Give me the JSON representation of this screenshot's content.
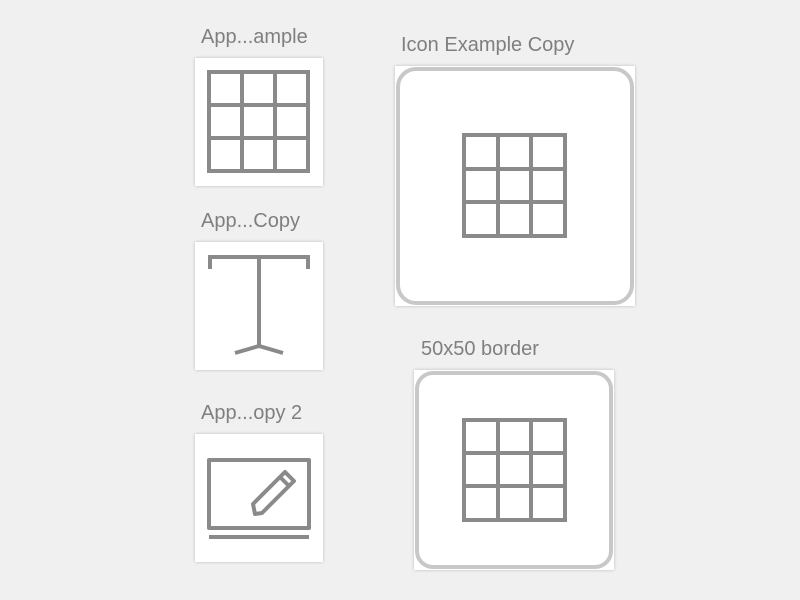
{
  "artboards": [
    {
      "label": "App...ample",
      "icon": "grid-icon"
    },
    {
      "label": "App...Copy",
      "icon": "text-cursor-icon"
    },
    {
      "label": "App...opy 2",
      "icon": "edit-screen-icon"
    },
    {
      "label": "Icon Example Copy",
      "icon": "grid-icon"
    },
    {
      "label": "50x50 border",
      "icon": "grid-icon"
    }
  ],
  "colors": {
    "background": "#f0f0f0",
    "icon_stroke": "#8a8a8a",
    "label_text": "#7f7f7f",
    "frame_border": "#c8c8c8"
  }
}
